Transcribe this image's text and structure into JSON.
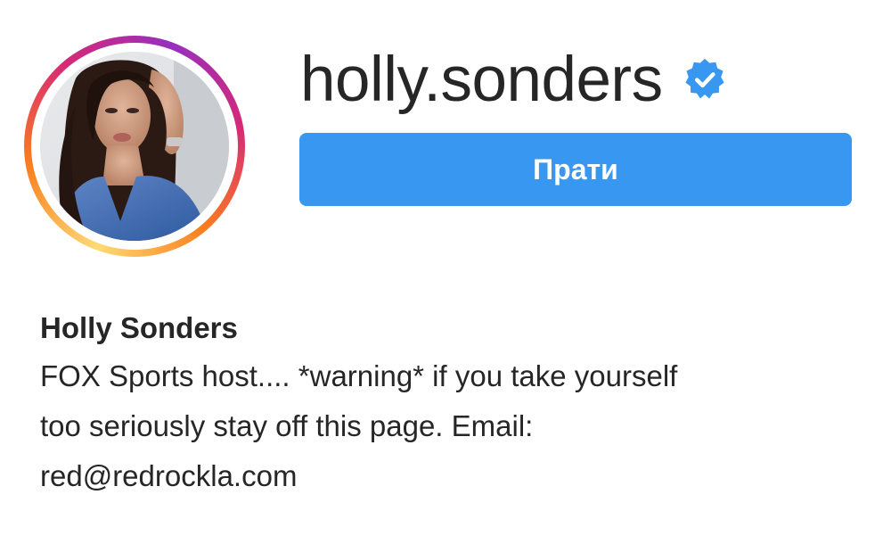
{
  "profile": {
    "username": "holly.sonders",
    "verified": true,
    "follow_label": "Прати",
    "full_name": "Holly Sonders",
    "bio_lines": [
      "FOX Sports host.... *warning* if you take yourself",
      "too seriously stay off this page. Email:",
      "red@redrockla.com"
    ]
  },
  "icons": {
    "verified": "verified-badge-icon",
    "avatar": "profile-avatar"
  },
  "colors": {
    "accent": "#3897f0",
    "verified_badge": "#3897f0",
    "text": "#262626",
    "ring_start": "#feda75",
    "ring_mid": "#d62976",
    "ring_end": "#962fbf"
  }
}
